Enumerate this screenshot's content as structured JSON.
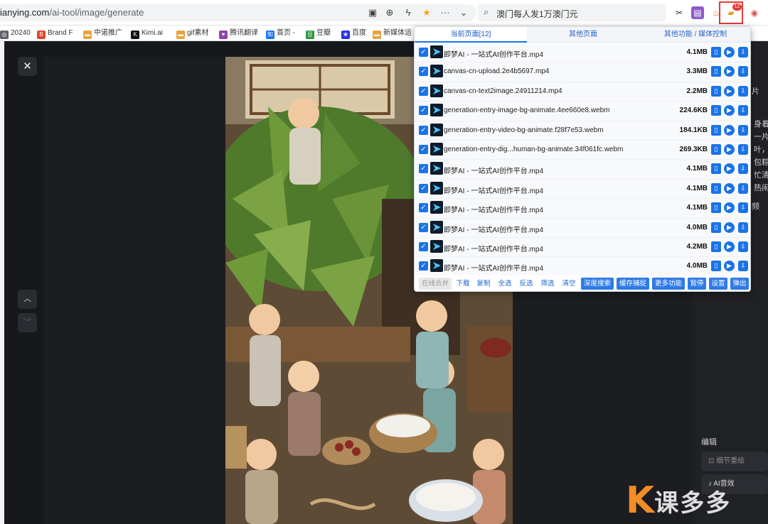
{
  "browser": {
    "url_host": "ianying.com",
    "url_path": "/ai-tool/image/generate",
    "search_text": "澳门每人发1万澳门元",
    "extension_badge": "12"
  },
  "bookmarks": [
    {
      "label": "20240",
      "color": "#5f6368",
      "icon": "globe-icon",
      "glyph": "◎"
    },
    {
      "label": "Brand F",
      "color": "#e0452b",
      "icon": "brand-icon",
      "glyph": "B"
    },
    {
      "label": "中诺推广",
      "color": "#e8a33d",
      "icon": "folder-icon",
      "glyph": "▬"
    },
    {
      "label": "Kimi.ai",
      "color": "#111111",
      "icon": "kimi-icon",
      "glyph": "K"
    },
    {
      "label": "gif素材",
      "color": "#e8a33d",
      "icon": "folder-icon",
      "glyph": "▬"
    },
    {
      "label": "腾讯翻译",
      "color": "#8e44ad",
      "icon": "heart-icon",
      "glyph": "♥"
    },
    {
      "label": "首页 -",
      "color": "#1772f6",
      "icon": "zhihu-icon",
      "glyph": "知"
    },
    {
      "label": "豆瓣",
      "color": "#2e963d",
      "icon": "douban-icon",
      "glyph": "豆"
    },
    {
      "label": "百度",
      "color": "#2932e1",
      "icon": "baidu-icon",
      "glyph": "❀"
    },
    {
      "label": "新媒体运",
      "color": "#e8a33d",
      "icon": "folder-icon",
      "glyph": "▬"
    }
  ],
  "popup": {
    "tabs": [
      "当前页面[12]",
      "其他页面",
      "其他功能 / 媒体控制"
    ],
    "files": [
      {
        "name": "即梦AI - 一站式AI创作平台.mp4",
        "size": "4.1MB"
      },
      {
        "name": "canvas-cn-upload.2e4b5697.mp4",
        "size": "3.3MB"
      },
      {
        "name": "canvas-cn-text2image.24911214.mp4",
        "size": "2.2MB"
      },
      {
        "name": "generation-entry-image-bg-animate.4ee660e8.webm",
        "size": "224.6KB"
      },
      {
        "name": "generation-entry-video-bg-animate.f28f7e53.webm",
        "size": "184.1KB"
      },
      {
        "name": "generation-entry-dig...human-bg-animate.34f061fc.webm",
        "size": "269.3KB"
      },
      {
        "name": "即梦AI - 一站式AI创作平台.mp4",
        "size": "4.1MB"
      },
      {
        "name": "即梦AI - 一站式AI创作平台.mp4",
        "size": "4.1MB"
      },
      {
        "name": "即梦AI - 一站式AI创作平台.mp4",
        "size": "4.1MB"
      },
      {
        "name": "即梦AI - 一站式AI创作平台.mp4",
        "size": "4.0MB"
      },
      {
        "name": "即梦AI - 一站式AI创作平台.mp4",
        "size": "4.2MB"
      },
      {
        "name": "即梦AI - 一站式AI创作平台.mp4",
        "size": "4.0MB"
      }
    ],
    "toolbar": {
      "merge": "在线合并",
      "download": "下载",
      "copy": "复制",
      "select_all": "全选",
      "invert": "反选",
      "filter": "筛选",
      "clear": "清空",
      "deep_search": "深度搜索",
      "cache_capture": "缓存捕捉",
      "more": "更多功能",
      "pause": "暂停",
      "settings": "设置",
      "popout": "弹出"
    }
  },
  "right_panel": {
    "label_pian": "片",
    "desc_lines": [
      "身着",
      "一片",
      "叶，",
      "包粽叶",
      "忙清洗",
      "热闹"
    ],
    "label_pin": "频",
    "edit_label": "编辑",
    "btn_hd": "细节重绘",
    "btn_music": "AI音效"
  },
  "watermark": {
    "text": "课多多"
  },
  "colors": {
    "accent": "#1a73e8",
    "popup_button": "#2f7be6",
    "watermark_orange": "#f28c28",
    "highlight_red": "#e53935"
  }
}
